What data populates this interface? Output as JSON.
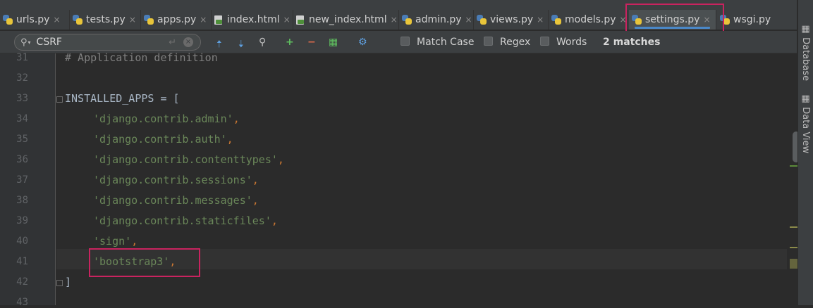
{
  "tabs": [
    {
      "label": "urls.py",
      "close": "×"
    },
    {
      "label": "tests.py",
      "close": "×"
    },
    {
      "label": "apps.py",
      "close": "×"
    },
    {
      "label": "index.html",
      "close": "×"
    },
    {
      "label": "new_index.html",
      "close": "×"
    },
    {
      "label": "admin.py",
      "close": "×"
    },
    {
      "label": "views.py",
      "close": "×"
    },
    {
      "label": "models.py",
      "close": "×"
    },
    {
      "label": "settings.py",
      "close": "×",
      "active": true
    },
    {
      "label": "wsgi.py",
      "close": ""
    }
  ],
  "find": {
    "query": "CSRF",
    "enter_glyph": "↵",
    "clear_glyph": "×",
    "match_case": "Match Case",
    "regex": "Regex",
    "words": "Words",
    "matches": "2 matches"
  },
  "lines": [
    {
      "num": "31",
      "text": "# Application definition"
    },
    {
      "num": "32",
      "text": ""
    },
    {
      "num": "33",
      "text": "INSTALLED_APPS = ["
    },
    {
      "num": "34",
      "str": "'django.contrib.admin'",
      "tail": ","
    },
    {
      "num": "35",
      "str": "'django.contrib.auth'",
      "tail": ","
    },
    {
      "num": "36",
      "str": "'django.contrib.contenttypes'",
      "tail": ","
    },
    {
      "num": "37",
      "str": "'django.contrib.sessions'",
      "tail": ","
    },
    {
      "num": "38",
      "str": "'django.contrib.messages'",
      "tail": ","
    },
    {
      "num": "39",
      "str": "'django.contrib.staticfiles'",
      "tail": ","
    },
    {
      "num": "40",
      "str": "'sign'",
      "tail": ","
    },
    {
      "num": "41",
      "str": "'bootstrap3'",
      "tail": ","
    },
    {
      "num": "42",
      "text": "]"
    },
    {
      "num": "43",
      "text": ""
    }
  ],
  "side_tools": {
    "database": "Database",
    "data_view": "Data View"
  },
  "colors": {
    "string": "#6a8759",
    "keyword": "#cc7832",
    "comment": "#808080",
    "highlight": "#c9235f",
    "accent": "#4a88c7"
  }
}
